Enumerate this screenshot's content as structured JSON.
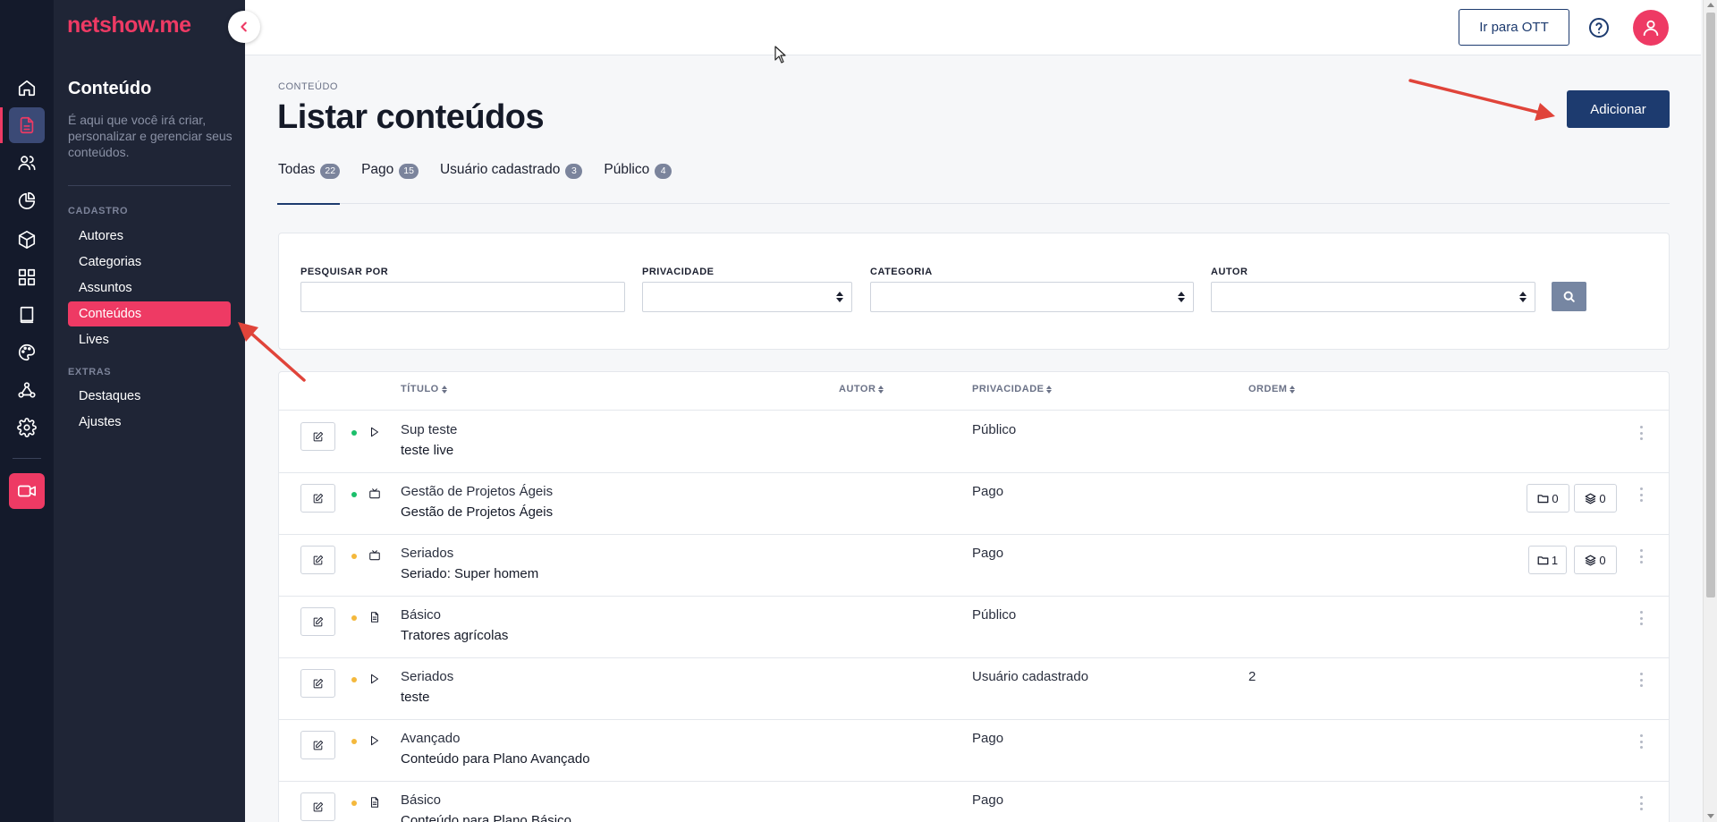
{
  "app": {
    "logo": "netshow.me"
  },
  "rail": {
    "items": [
      {
        "name": "home-icon"
      },
      {
        "name": "content-icon",
        "active": true
      },
      {
        "name": "users-icon"
      },
      {
        "name": "analytics-icon"
      },
      {
        "name": "package-icon"
      },
      {
        "name": "grid-icon"
      },
      {
        "name": "book-icon"
      },
      {
        "name": "palette-icon"
      },
      {
        "name": "webhook-icon"
      },
      {
        "name": "settings-icon"
      },
      {
        "name": "live-video-icon"
      }
    ]
  },
  "sidebar": {
    "title": "Conteúdo",
    "description": "É aqui que você irá criar, personalizar e gerenciar seus conteúdos.",
    "sections": [
      {
        "label": "CADASTRO",
        "items": [
          {
            "label": "Autores"
          },
          {
            "label": "Categorias"
          },
          {
            "label": "Assuntos"
          },
          {
            "label": "Conteúdos",
            "active": true
          },
          {
            "label": "Lives"
          }
        ]
      },
      {
        "label": "EXTRAS",
        "items": [
          {
            "label": "Destaques"
          },
          {
            "label": "Ajustes"
          }
        ]
      }
    ]
  },
  "topbar": {
    "ott_button": "Ir para OTT"
  },
  "page": {
    "breadcrumb": "CONTEÚDO",
    "title": "Listar conteúdos",
    "add_button": "Adicionar"
  },
  "tabs": [
    {
      "label": "Todas",
      "count": "22",
      "active": true
    },
    {
      "label": "Pago",
      "count": "15"
    },
    {
      "label": "Usuário cadastrado",
      "count": "3"
    },
    {
      "label": "Público",
      "count": "4"
    }
  ],
  "filters": {
    "search_label": "PESQUISAR POR",
    "privacy_label": "PRIVACIDADE",
    "category_label": "CATEGORIA",
    "author_label": "AUTOR"
  },
  "table": {
    "columns": {
      "title": "TÍTULO",
      "author": "AUTOR",
      "privacy": "PRIVACIDADE",
      "order": "ORDEM"
    },
    "rows": [
      {
        "status": "green",
        "type": "play-icon",
        "category": "Sup teste",
        "title": "teste live",
        "privacy": "Público",
        "order": ""
      },
      {
        "status": "green",
        "type": "tv-icon",
        "category": "Gestão de Projetos Ágeis",
        "title": "Gestão de Projetos Ágeis",
        "privacy": "Pago",
        "order": "",
        "folders": "0",
        "layers": "0"
      },
      {
        "status": "yellow",
        "type": "tv-icon",
        "category": "Seriados",
        "title": "Seriado: Super homem",
        "privacy": "Pago",
        "order": "",
        "folders": "1",
        "layers": "0"
      },
      {
        "status": "yellow",
        "type": "document-icon",
        "category": "Básico",
        "title": "Tratores agrícolas",
        "privacy": "Público",
        "order": ""
      },
      {
        "status": "yellow",
        "type": "play-icon",
        "category": "Seriados",
        "title": "teste",
        "privacy": "Usuário cadastrado",
        "order": "2"
      },
      {
        "status": "yellow",
        "type": "play-icon",
        "category": "Avançado",
        "title": "Conteúdo para Plano Avançado",
        "privacy": "Pago",
        "order": ""
      },
      {
        "status": "yellow",
        "type": "document-icon",
        "category": "Básico",
        "title": "Conteúdo para Plano Básico",
        "privacy": "Pago",
        "order": ""
      }
    ]
  },
  "colors": {
    "brand": "#ee3a64",
    "primary": "#1d3b6f",
    "rail_bg": "#141a2b",
    "panel_bg": "#1f2536",
    "status_green": "#1bbf6b",
    "status_yellow": "#f4b83c",
    "annotation_arrow": "#e0443a"
  }
}
